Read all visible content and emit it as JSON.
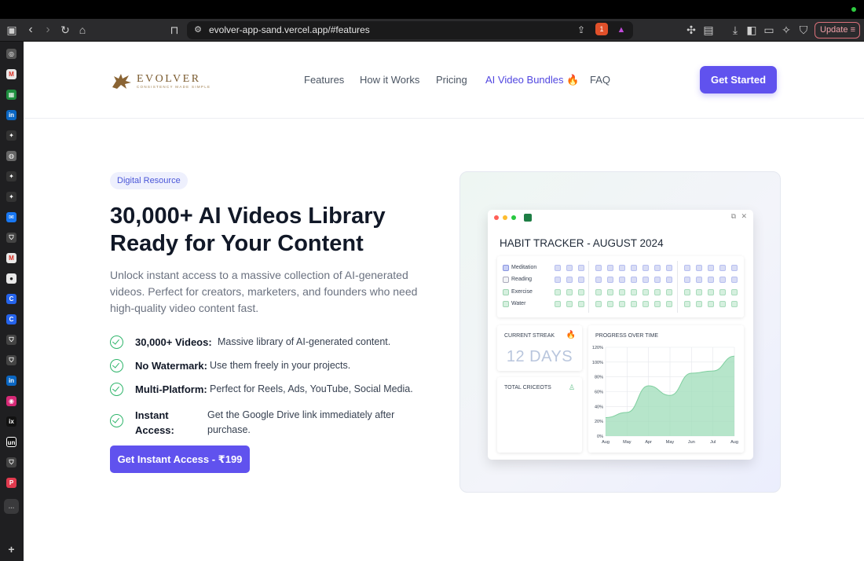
{
  "browser": {
    "url": "evolver-app-sand.vercel.app/#features",
    "update_label": "Update",
    "extension_badge": "1"
  },
  "nav": {
    "logo_word": "EVOLVER",
    "logo_tagline": "CONSISTENCY MADE SIMPLE",
    "links": [
      "Features",
      "How it Works",
      "Pricing",
      "AI Video Bundles 🔥",
      "FAQ"
    ],
    "cta": "Get Started"
  },
  "hero": {
    "badge": "Digital Resource",
    "headline": "30,000+ AI Videos Library Ready for Your Content",
    "subtext": "Unlock instant access to a massive collection of AI-generated videos. Perfect for creators, marketers, and founders who need high-quality video content fast.",
    "features": [
      {
        "title": "30,000+ Videos:",
        "desc": "Massive library of AI-generated content."
      },
      {
        "title": "No Watermark:",
        "desc": "Use them freely in your projects."
      },
      {
        "title": "Multi-Platform:",
        "desc": "Perfect for Reels, Ads, YouTube, Social Media."
      },
      {
        "title": "Instant Access:",
        "desc": "Get the Google Drive link immediately after purchase."
      }
    ],
    "cta": "Get Instant Access - ₹199"
  },
  "tracker": {
    "title": "HABIT TRACKER - AUGUST 2024",
    "habits": [
      {
        "label": "Meditation",
        "color": "#d9ddf5"
      },
      {
        "label": "Reading",
        "color": "#d9ddf5"
      },
      {
        "label": "Exercise",
        "color": "#d6f0df"
      },
      {
        "label": "Water",
        "color": "#d6f0df"
      }
    ],
    "streak_label": "CURRENT STREAK",
    "streak_value": "12 DAYS",
    "calories_label": "TOTAL CRICEOTS",
    "progress_label": "PROGRESS OVER TIME"
  },
  "chart_data": {
    "type": "area",
    "title": "PROGRESS OVER TIME",
    "x": [
      "Aug",
      "May",
      "Apr",
      "May",
      "Jun",
      "Jul",
      "Aug"
    ],
    "y_ticks": [
      "0%",
      "20%",
      "40%",
      "60%",
      "80%",
      "100%",
      "120%"
    ],
    "ylim": [
      0,
      120
    ],
    "values": [
      25,
      32,
      68,
      55,
      85,
      88,
      108
    ],
    "color": "#9ddcb8"
  },
  "colors": {
    "accent": "#6052ee",
    "check_green": "#2fb56b"
  }
}
